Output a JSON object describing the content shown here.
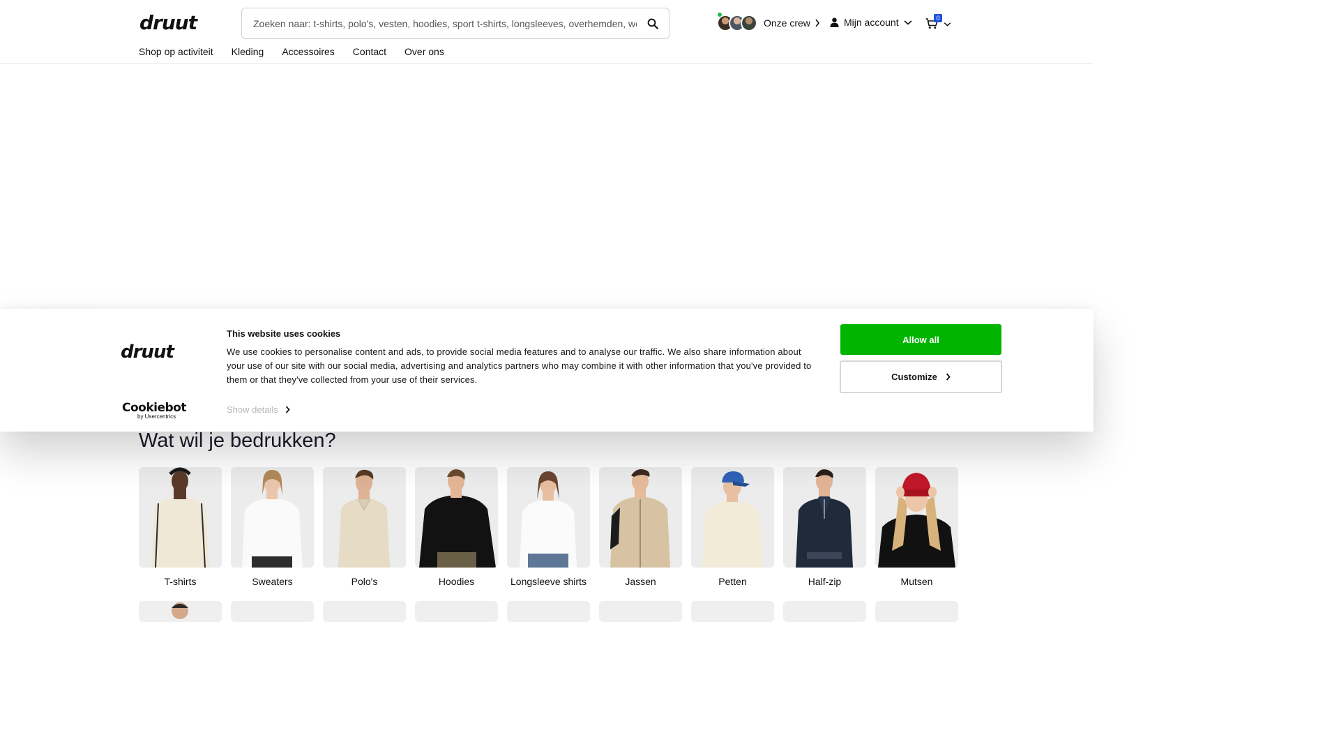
{
  "header": {
    "logo": "druut",
    "search_placeholder": "Zoeken naar: t-shirts, polo's, vesten, hoodies, sport t-shirts, longsleeves, overhemden, werkkl...",
    "crew_label": "Onze crew",
    "account_label": "Mijn account",
    "cart_count": "0"
  },
  "nav": {
    "items": [
      {
        "label": "Shop op activiteit"
      },
      {
        "label": "Kleding"
      },
      {
        "label": "Accessoires"
      },
      {
        "label": "Contact"
      },
      {
        "label": "Over ons"
      }
    ]
  },
  "section": {
    "title": "Wat wil je bedrukken?",
    "categories": [
      {
        "label": "T-shirts",
        "icon": "person-tshirt-image"
      },
      {
        "label": "Sweaters",
        "icon": "person-sweater-image"
      },
      {
        "label": "Polo's",
        "icon": "person-polo-image"
      },
      {
        "label": "Hoodies",
        "icon": "person-hoodie-image"
      },
      {
        "label": "Longsleeve shirts",
        "icon": "person-longsleeve-image"
      },
      {
        "label": "Jassen",
        "icon": "person-jacket-image"
      },
      {
        "label": "Petten",
        "icon": "person-cap-image"
      },
      {
        "label": "Half-zip",
        "icon": "person-halfzip-image"
      },
      {
        "label": "Mutsen",
        "icon": "person-beanie-image"
      }
    ]
  },
  "cookie": {
    "logo": "druut",
    "cookiebot_logo": "Cookiebot",
    "cookiebot_sub": "by Usercentrics",
    "title": "This website uses cookies",
    "text": "We use cookies to personalise content and ads, to provide social media features and to analyse our traffic. We also share information about your use of our site with our social media, advertising and analytics partners who may combine it with other information that you've provided to them or that they've collected from your use of their services.",
    "show_details": "Show details",
    "allow_all": "Allow all",
    "customize": "Customize"
  },
  "colors": {
    "allow_button": "#00b400",
    "cart_badge": "#1f4fe0",
    "online_dot": "#1db954"
  }
}
